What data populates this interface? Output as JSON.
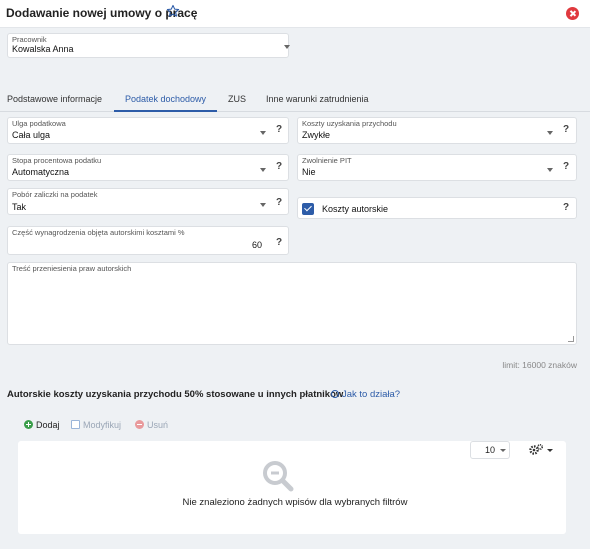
{
  "header": {
    "title": "Dodawanie nowej umowy o pracę",
    "favorite_icon": "star-icon",
    "close_icon": "close-icon"
  },
  "employee": {
    "label": "Pracownik",
    "value": "Kowalska Anna"
  },
  "tabs": [
    {
      "label": "Podstawowe informacje",
      "active": false
    },
    {
      "label": "Podatek dochodowy",
      "active": true
    },
    {
      "label": "ZUS",
      "active": false
    },
    {
      "label": "Inne warunki zatrudnienia",
      "active": false
    }
  ],
  "form": {
    "ulga": {
      "label": "Ulga podatkowa",
      "value": "Cała ulga"
    },
    "koszty": {
      "label": "Koszty uzyskania przychodu",
      "value": "Zwykłe"
    },
    "stopa": {
      "label": "Stopa procentowa podatku",
      "value": "Automatyczna"
    },
    "zwolnienie": {
      "label": "Zwolnienie PIT",
      "value": "Nie"
    },
    "pobor": {
      "label": "Pobór zaliczki na podatek",
      "value": "Tak"
    },
    "koszty_autorskie": {
      "label": "Koszty autorskie",
      "checked": true
    },
    "czesc": {
      "label": "Część wynagrodzenia objęta autorskimi kosztami %",
      "value": "60"
    },
    "tresc": {
      "label": "Treść przeniesienia praw autorskich",
      "value": ""
    },
    "help": "?"
  },
  "limit_text": "limit: 16000 znaków",
  "section": {
    "title": "Autorskie koszty uzyskania przychodu 50% stosowane u innych płatników",
    "info_link": "Jak to działa?"
  },
  "toolbar": {
    "add": "Dodaj",
    "modify": "Modyfikuj",
    "delete": "Usuń"
  },
  "grid": {
    "page_size": "10",
    "empty_message": "Nie znaleziono żadnych wpisów dla wybranych filtrów"
  },
  "colors": {
    "accent": "#2d5ca8",
    "close": "#e0393e",
    "add": "#3a9d4a"
  }
}
